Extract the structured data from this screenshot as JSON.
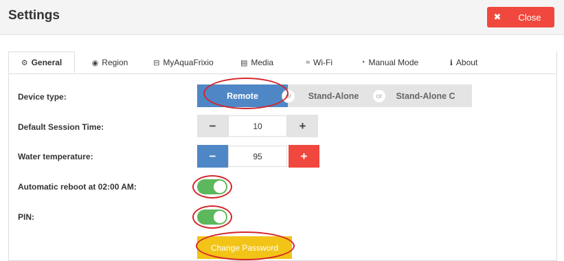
{
  "header": {
    "title": "Settings",
    "close_label": "Close"
  },
  "tabs": [
    {
      "label": "General",
      "icon": "cogs-icon"
    },
    {
      "label": "Region",
      "icon": "globe-icon"
    },
    {
      "label": "MyAquaFrixio",
      "icon": "lock-icon"
    },
    {
      "label": "Media",
      "icon": "film-icon"
    },
    {
      "label": "Wi-Fi",
      "icon": "wifi-icon"
    },
    {
      "label": "Manual Mode",
      "icon": "tachometer-icon"
    },
    {
      "label": "About",
      "icon": "info-icon"
    }
  ],
  "general": {
    "device_type": {
      "label": "Device type:",
      "options": [
        "Remote",
        "Stand-Alone",
        "Stand-Alone C"
      ],
      "selected": "Remote",
      "separator": "or"
    },
    "session_time": {
      "label": "Default Session Time:",
      "value": "10",
      "minus": "−",
      "plus": "+"
    },
    "water_temp": {
      "label": "Water temperature:",
      "value": "95",
      "minus": "−",
      "plus": "+"
    },
    "auto_reboot": {
      "label": "Automatic reboot at 02:00 AM:",
      "on": true
    },
    "pin": {
      "label": "PIN:",
      "on": true
    },
    "change_password_label": "Change Password"
  },
  "colors": {
    "primary": "#4f87c6",
    "danger": "#f0483e",
    "success": "#5cb85c",
    "warning": "#f2c417",
    "annotation": "#d4242a"
  }
}
